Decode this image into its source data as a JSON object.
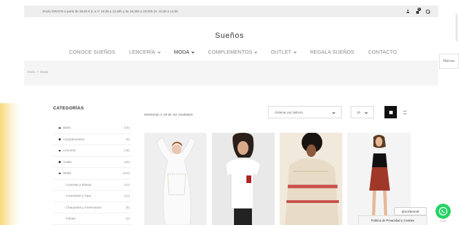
{
  "topbar": {
    "shipping_text": "Envío GRATIS a partir de 39,90 € (L a V: 10:30 a 13:30h y de 16:30h a 20:00h (S: 10:30 a 14:00",
    "cart_count": "0",
    "icons": [
      "user-icon",
      "bag-icon",
      "search-icon"
    ]
  },
  "brand": {
    "logo": "Sueños"
  },
  "nav": {
    "items": [
      {
        "label": "CONOCE SUEÑOS",
        "has_dropdown": false,
        "active": false
      },
      {
        "label": "LENCERÍA",
        "has_dropdown": true,
        "active": false
      },
      {
        "label": "MODA",
        "has_dropdown": true,
        "active": true
      },
      {
        "label": "COMPLEMENTOS",
        "has_dropdown": true,
        "active": false
      },
      {
        "label": "OUTLET",
        "has_dropdown": true,
        "active": false
      },
      {
        "label": "REGALA SUEÑOS",
        "has_dropdown": false,
        "active": false
      },
      {
        "label": "CONTACTO",
        "has_dropdown": false,
        "active": false
      }
    ]
  },
  "breadcrumb": {
    "home": "Inicio",
    "separator": "/",
    "current": "Moda"
  },
  "side_tab": {
    "label": "Marcas"
  },
  "sidebar": {
    "title": "CATEGORÍAS",
    "categories": [
      {
        "label": "Baño",
        "count": "(15)",
        "sub": false
      },
      {
        "label": "Complementos",
        "count": "(9)",
        "sub": false
      },
      {
        "label": "Lencería",
        "count": "(45)",
        "sub": false
      },
      {
        "label": "Outlet",
        "count": "(20)",
        "sub": false
      },
      {
        "label": "Moda",
        "count": "(110)",
        "sub": false
      },
      {
        "label": "- Camisas y Blusas",
        "count": "(14)",
        "sub": true
      },
      {
        "label": "- Camisetas y Tops",
        "count": "(12)",
        "sub": true
      },
      {
        "label": "- Chaquetas y Americanas",
        "count": "(5)",
        "sub": true
      },
      {
        "label": "- Faldas",
        "count": "(4)",
        "sub": true
      }
    ]
  },
  "toolbar": {
    "results_text": "Mostrando 1–20 de 111 resultados",
    "sort_value": "Ordenar por defecto",
    "per_page_value": "20",
    "view_modes": [
      "grid-view-icon",
      "list-view-icon"
    ]
  },
  "products": [
    {
      "image_icon": "product-white-embroidered-blouse-icon"
    },
    {
      "image_icon": "product-white-graphic-tee-icon"
    },
    {
      "image_icon": "product-striped-knit-poncho-icon"
    },
    {
      "image_icon": "product-red-leather-skirt-icon"
    }
  ],
  "chat": {
    "bubble_text": "¡Escríbenos!",
    "caption": "Joinchat"
  },
  "privacy": {
    "label": "Política de Privacidad y Cookies"
  },
  "colors": {
    "whatsapp": "#25d366",
    "topbar_bg": "#eeeeee",
    "band_bg": "#f5f5f5",
    "accent_dark": "#111111"
  }
}
